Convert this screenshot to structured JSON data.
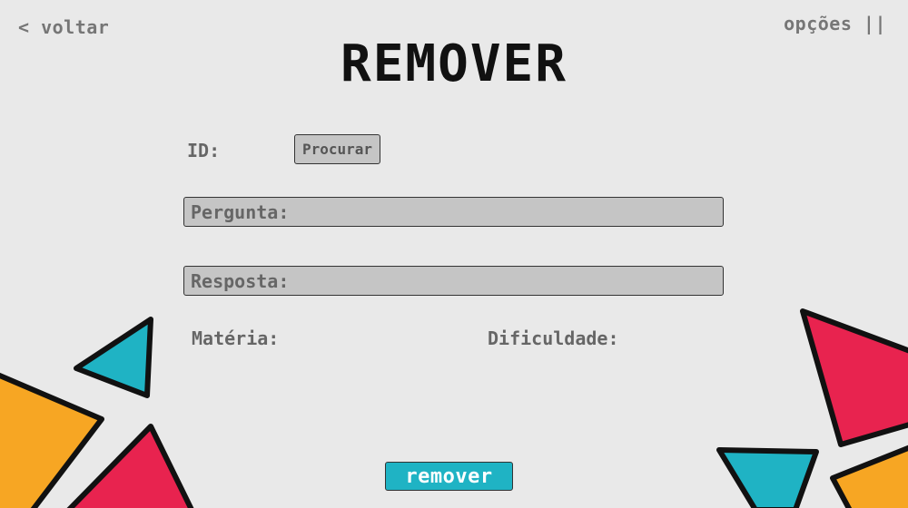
{
  "nav": {
    "back_label": "< voltar",
    "options_label": "opções ||"
  },
  "title": "REMOVER",
  "form": {
    "id_label": "ID:",
    "search_button": "Procurar",
    "question_label": "Pergunta:",
    "answer_label": "Resposta:",
    "subject_label": "Matéria:",
    "difficulty_label": "Dificuldade:"
  },
  "remove_button": "remover",
  "colors": {
    "background": "#e9e9e9",
    "teal": "#1fb3c4",
    "orange": "#f7a623",
    "pink": "#e8234f",
    "field": "#c5c5c5"
  }
}
